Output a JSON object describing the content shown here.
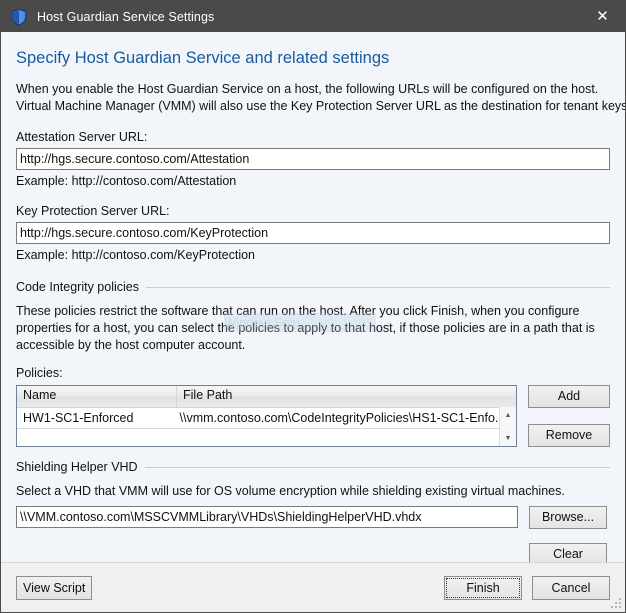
{
  "window": {
    "title": "Host Guardian Service Settings",
    "icon": "shield-icon",
    "close_label": "✕",
    "accent_color": "#19599c",
    "titlebar_color": "#4c4a48"
  },
  "page": {
    "heading": "Specify Host Guardian Service and related settings",
    "intro_line1": "When you enable the Host Guardian Service on a host, the following URLs will be configured on the host.",
    "intro_line2": "Virtual Machine Manager (VMM) will also use the Key Protection Server URL as the destination for tenant keys."
  },
  "attestation": {
    "label": "Attestation Server URL:",
    "value": "http://hgs.secure.contoso.com/Attestation",
    "placeholder": "",
    "example": "Example: http://contoso.com/Attestation"
  },
  "key_protection": {
    "label": "Key Protection Server URL:",
    "value": "http://hgs.secure.contoso.com/KeyProtection",
    "placeholder": "",
    "example": "Example: http://contoso.com/KeyProtection"
  },
  "code_integrity": {
    "group_title": "Code Integrity policies",
    "description_line1": "These policies restrict the software that can run on the host. After you click Finish, when you configure",
    "description_line2": "properties for a host, you can select the policies to apply to that host, if those policies are in a path that is",
    "description_line3": "accessible by the host computer account.",
    "policies_label": "Policies:",
    "columns": [
      "Name",
      "File Path"
    ],
    "rows": [
      {
        "name": "HW1-SC1-Enforced",
        "path": "\\\\vmm.contoso.com\\CodeIntegrityPolicies\\HS1-SC1-Enfo..."
      }
    ],
    "add_label": "Add",
    "remove_label": "Remove",
    "scroll_up_icon": "▲",
    "scroll_down_icon": "▼"
  },
  "shielding_vhd": {
    "group_title": "Shielding Helper VHD",
    "description": "Select a VHD that VMM will use for OS volume encryption while shielding existing virtual machines.",
    "value": "\\\\VMM.contoso.com\\MSSCVMMLibrary\\VHDs\\ShieldingHelperVHD.vhdx",
    "placeholder": "",
    "browse_label": "Browse...",
    "clear_label": "Clear"
  },
  "footer": {
    "view_script_label": "View Script",
    "finish_label": "Finish",
    "cancel_label": "Cancel"
  },
  "overlay": {
    "watermark_text": "Window Snip"
  }
}
